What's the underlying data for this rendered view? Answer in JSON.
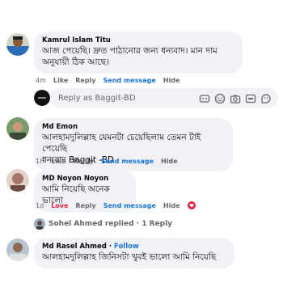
{
  "comments": [
    {
      "name": "Kamrul Islam Titu",
      "text": "আজ পেয়েছি। দ্রুত পাঠানোর জন্য ধন্যবাদ। মান দাম\nঅনুযায়ী ঠিক আছে।",
      "time": "4m",
      "like": "Like",
      "reply": "Reply",
      "send": "Send message",
      "hide": "Hide"
    },
    {
      "name": "Md Emon",
      "text": "আলহামদুলিল্লাহ যেমনটা চেয়েছিলাম তেমন টাই পেয়েছি\nধন্যবাদ Baggit -BD",
      "time": "1h",
      "like": "Like",
      "reply": "Reply",
      "send": "Send message",
      "hide": "Hide"
    },
    {
      "name": "MD Noyon Noyon",
      "text": "আমি নিয়েছি অনেক ভালো",
      "time": "1d",
      "like": "Love",
      "reply": "Reply",
      "send": "Send message",
      "hide": "Hide"
    },
    {
      "name": "Md Rasel Ahmed",
      "follow": "Follow",
      "text": "আলহামদুলিল্লাহ জিনিসটা খুবই ভালো আমি নিয়েছি"
    }
  ],
  "reply_box": {
    "placeholder": "Reply as Baggit-BD",
    "icons": [
      "sticker-icon",
      "emoji-icon",
      "camera-icon",
      "gif-icon",
      "sticker-face-icon"
    ]
  },
  "replies_summary": {
    "text": "Sohel Ahmed replied · 1 Reply"
  },
  "colors": {
    "bubble": "#f0f2f5",
    "link": "#1b74e4",
    "love": "#e41e3f",
    "muted": "#65676b"
  }
}
